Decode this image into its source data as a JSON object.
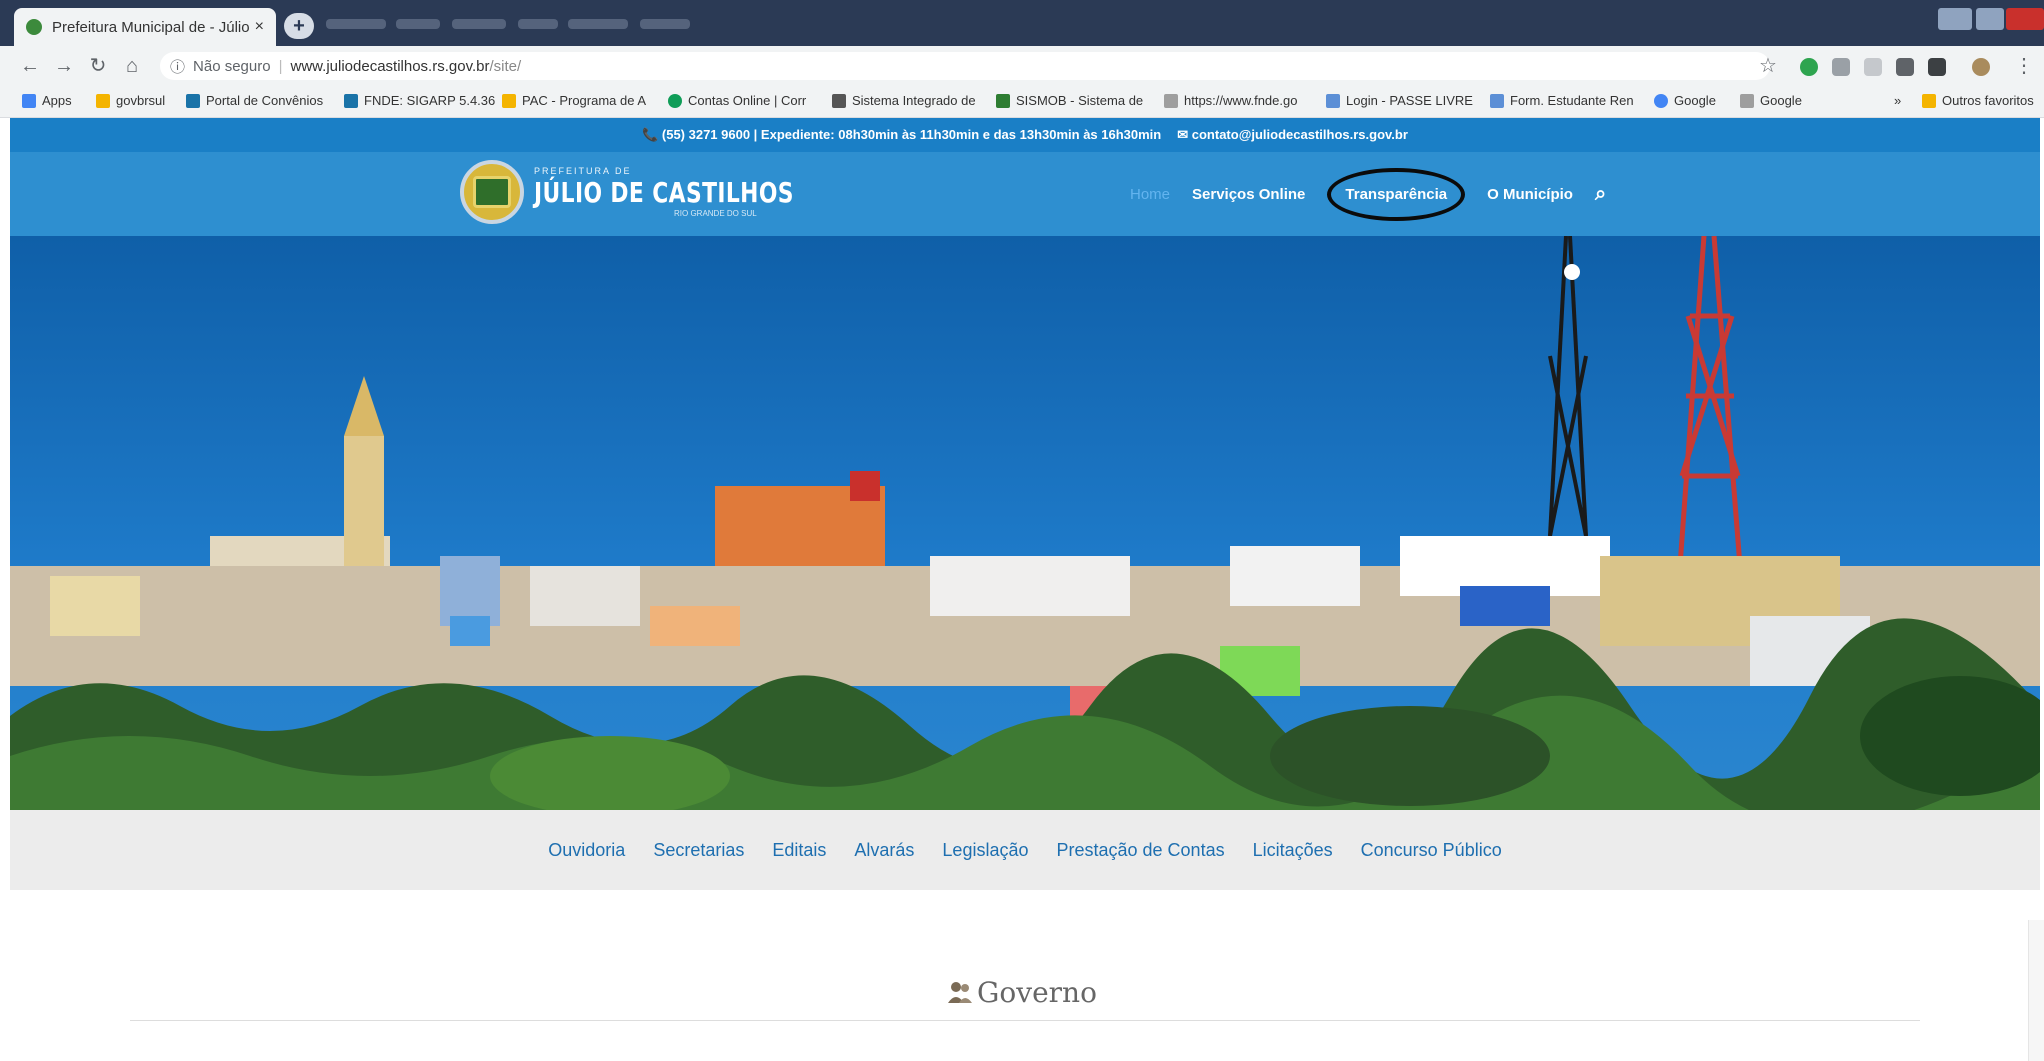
{
  "browser": {
    "tab_title": "Prefeitura Municipal de - Júlio de Castilhos",
    "tab_close": "×",
    "new_tab": "+",
    "url_info": "ⓘ",
    "url_not_secure": "Não seguro",
    "url_host": "www.juliodecastilhos.rs.gov.br",
    "url_path": "/site/",
    "bookmarks": [
      {
        "label": "Apps",
        "color": "#4285f4"
      },
      {
        "label": "govbrsul",
        "color": "#f4b400"
      },
      {
        "label": "Portal de Convênios",
        "color": "#1a73a8"
      },
      {
        "label": "FNDE: SIGARP 5.4.36",
        "color": "#1a73a8"
      },
      {
        "label": "PAC - Programa de A",
        "color": "#f4b400"
      },
      {
        "label": "Contas Online | Corr",
        "color": "#0f9d58"
      },
      {
        "label": "Sistema Integrado de",
        "color": "#555555"
      },
      {
        "label": "SISMOB - Sistema de",
        "color": "#2e7d32"
      },
      {
        "label": "https://www.fnde.go",
        "color": "#9e9e9e"
      },
      {
        "label": "Login - PASSE LIVRE",
        "color": "#5c8fd6"
      },
      {
        "label": "Form. Estudante Ren",
        "color": "#5c8fd6"
      },
      {
        "label": "Google",
        "color": "#4285f4"
      },
      {
        "label": "Google",
        "color": "#9e9e9e"
      }
    ],
    "bookmarks_more": "»",
    "bookmarks_other": "Outros favoritos"
  },
  "site": {
    "topbar": {
      "phone": "(55) 3271 9600 | Expediente: 08h30min às 11h30min e das 13h30min às 16h30min",
      "email": "contato@juliodecastilhos.rs.gov.br"
    },
    "logo": {
      "small": "PREFEITURA DE",
      "big": "JÚLIO DE CASTILHOS",
      "sub": "RIO GRANDE DO SUL"
    },
    "mainnav": {
      "home": "Home",
      "servicos": "Serviços Online",
      "transparencia": "Transparência",
      "municipio": "O Município"
    },
    "secnav": [
      "Ouvidoria",
      "Secretarias",
      "Editais",
      "Alvarás",
      "Legislação",
      "Prestação de Contas",
      "Licitações",
      "Concurso Público"
    ],
    "section_title": "Governo"
  },
  "colors": {
    "topbar": "#1a7fc6",
    "header": "#2e8fd0",
    "secnav_link": "#1e6fb0",
    "highlight_ellipse": "#0b0b0b"
  }
}
